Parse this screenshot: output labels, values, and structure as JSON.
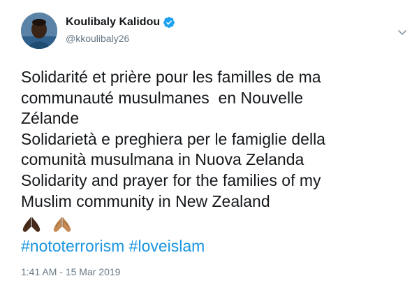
{
  "author": {
    "display_name": "Koulibaly Kalidou",
    "handle": "@kkoulibaly26",
    "verified": true
  },
  "tweet": {
    "text": "Solidarité et prière pour les familles de ma\ncommunauté musulmanes  en Nouvelle\nZélande\nSolidarietà e preghiera per le famiglie della\ncomunità musulmana in Nuova Zelanda\nSolidarity and prayer for the families of my\nMuslim community in New Zealand",
    "emojis": [
      "praying-hands-dark-icon",
      "praying-hands-medium-icon"
    ],
    "hashtags": [
      "#nototerrorism",
      "#loveislam"
    ],
    "time": "1:41 AM",
    "date": "15 Mar 2019",
    "separator": "-"
  },
  "colors": {
    "link": "#1b95e0",
    "secondary_text": "#657786",
    "primary_text": "#14171a",
    "verified_badge": "#1da1f2"
  }
}
